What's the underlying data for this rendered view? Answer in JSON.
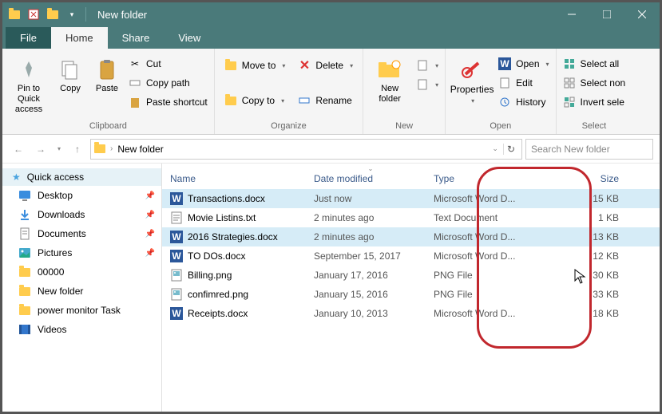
{
  "window": {
    "title": "New folder"
  },
  "tabs": {
    "file": "File",
    "home": "Home",
    "share": "Share",
    "view": "View"
  },
  "ribbon": {
    "clipboard": {
      "label": "Clipboard",
      "pin": "Pin to Quick access",
      "copy": "Copy",
      "paste": "Paste",
      "cut": "Cut",
      "copy_path": "Copy path",
      "paste_shortcut": "Paste shortcut"
    },
    "organize": {
      "label": "Organize",
      "move_to": "Move to",
      "copy_to": "Copy to",
      "delete": "Delete",
      "rename": "Rename"
    },
    "new": {
      "label": "New",
      "new_folder": "New folder"
    },
    "open": {
      "label": "Open",
      "properties": "Properties",
      "open": "Open",
      "edit": "Edit",
      "history": "History"
    },
    "select": {
      "label": "Select",
      "select_all": "Select all",
      "select_none": "Select non",
      "invert": "Invert sele"
    }
  },
  "address": {
    "path": "New folder",
    "search_placeholder": "Search New folder"
  },
  "sidebar": {
    "quick_access": "Quick access",
    "items": [
      {
        "label": "Desktop",
        "icon": "desktop",
        "pinned": true
      },
      {
        "label": "Downloads",
        "icon": "downloads",
        "pinned": true
      },
      {
        "label": "Documents",
        "icon": "documents",
        "pinned": true
      },
      {
        "label": "Pictures",
        "icon": "pictures",
        "pinned": true
      },
      {
        "label": "00000",
        "icon": "folder",
        "pinned": false
      },
      {
        "label": "New folder",
        "icon": "folder",
        "pinned": false
      },
      {
        "label": "power monitor Task",
        "icon": "folder",
        "pinned": false
      },
      {
        "label": "Videos",
        "icon": "videos",
        "pinned": false
      }
    ]
  },
  "columns": {
    "name": "Name",
    "date": "Date modified",
    "type": "Type",
    "size": "Size"
  },
  "files": [
    {
      "name": "Transactions.docx",
      "date": "Just now",
      "type": "Microsoft Word D...",
      "size": "15 KB",
      "icon": "word",
      "selected": true
    },
    {
      "name": "Movie Listins.txt",
      "date": "2 minutes ago",
      "type": "Text Document",
      "size": "1 KB",
      "icon": "text",
      "selected": false
    },
    {
      "name": "2016 Strategies.docx",
      "date": "2 minutes ago",
      "type": "Microsoft Word D...",
      "size": "13 KB",
      "icon": "word",
      "selected": true
    },
    {
      "name": "TO DOs.docx",
      "date": "September 15, 2017",
      "type": "Microsoft Word D...",
      "size": "12 KB",
      "icon": "word",
      "selected": false
    },
    {
      "name": "Billing.png",
      "date": "January 17, 2016",
      "type": "PNG File",
      "size": "30 KB",
      "icon": "image",
      "selected": false
    },
    {
      "name": "confimred.png",
      "date": "January 15, 2016",
      "type": "PNG File",
      "size": "33 KB",
      "icon": "image",
      "selected": false
    },
    {
      "name": "Receipts.docx",
      "date": "January 10, 2013",
      "type": "Microsoft Word D...",
      "size": "18 KB",
      "icon": "word",
      "selected": false
    }
  ]
}
